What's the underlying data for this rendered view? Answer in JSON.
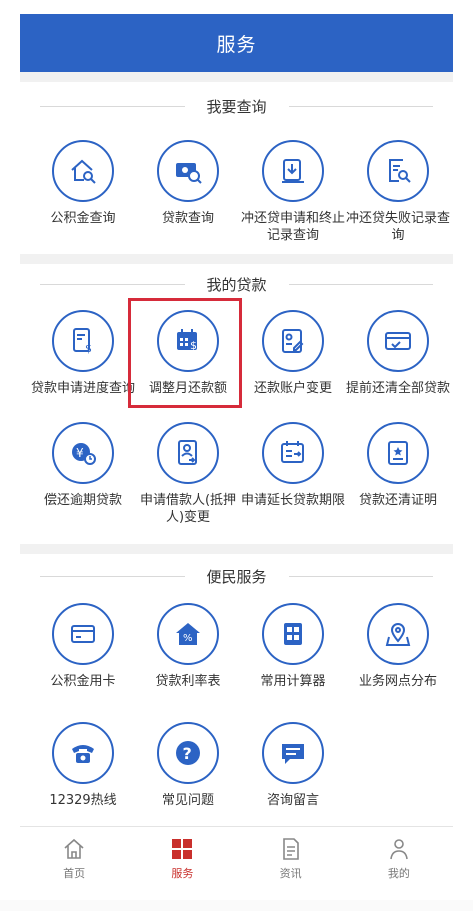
{
  "header": {
    "title": "服务"
  },
  "sections": {
    "query": {
      "title": "我要查询",
      "items": [
        {
          "label": "公积金查询",
          "icon": "house-search-icon"
        },
        {
          "label": "贷款查询",
          "icon": "card-search-icon"
        },
        {
          "label": "冲还贷申请和终止记录查询",
          "icon": "doc-download-icon"
        },
        {
          "label": "冲还贷失败记录查询",
          "icon": "doc-search-icon"
        }
      ]
    },
    "loans": {
      "title": "我的贷款",
      "items": [
        {
          "label": "贷款申请进度查询",
          "icon": "doc-dollar-icon"
        },
        {
          "label": "调整月还款额",
          "icon": "calendar-dollar-icon"
        },
        {
          "label": "还款账户变更",
          "icon": "account-edit-icon"
        },
        {
          "label": "提前还清全部贷款",
          "icon": "card-check-icon"
        },
        {
          "label": "偿还逾期贷款",
          "icon": "yen-coin-icon"
        },
        {
          "label": "申请借款人(抵押人)变更",
          "icon": "person-swap-icon"
        },
        {
          "label": "申请延长贷款期限",
          "icon": "calendar-extend-icon"
        },
        {
          "label": "贷款还清证明",
          "icon": "certificate-icon"
        }
      ]
    },
    "services": {
      "title": "便民服务",
      "items": [
        {
          "label": "公积金用卡",
          "icon": "card-icon"
        },
        {
          "label": "贷款利率表",
          "icon": "house-percent-icon"
        },
        {
          "label": "常用计算器",
          "icon": "calculator-icon"
        },
        {
          "label": "业务网点分布",
          "icon": "map-pin-icon"
        },
        {
          "label": "12329热线",
          "icon": "phone-icon"
        },
        {
          "label": "常见问题",
          "icon": "question-icon"
        },
        {
          "label": "咨询留言",
          "icon": "message-icon"
        }
      ]
    }
  },
  "tabbar": {
    "items": [
      {
        "label": "首页",
        "icon": "home-icon"
      },
      {
        "label": "服务",
        "icon": "grid-icon",
        "active": true
      },
      {
        "label": "资讯",
        "icon": "news-icon"
      },
      {
        "label": "我的",
        "icon": "person-icon"
      }
    ]
  },
  "colors": {
    "brand": "#2c63c4",
    "highlight": "#d62b3a",
    "active_tab": "#c9302c"
  }
}
